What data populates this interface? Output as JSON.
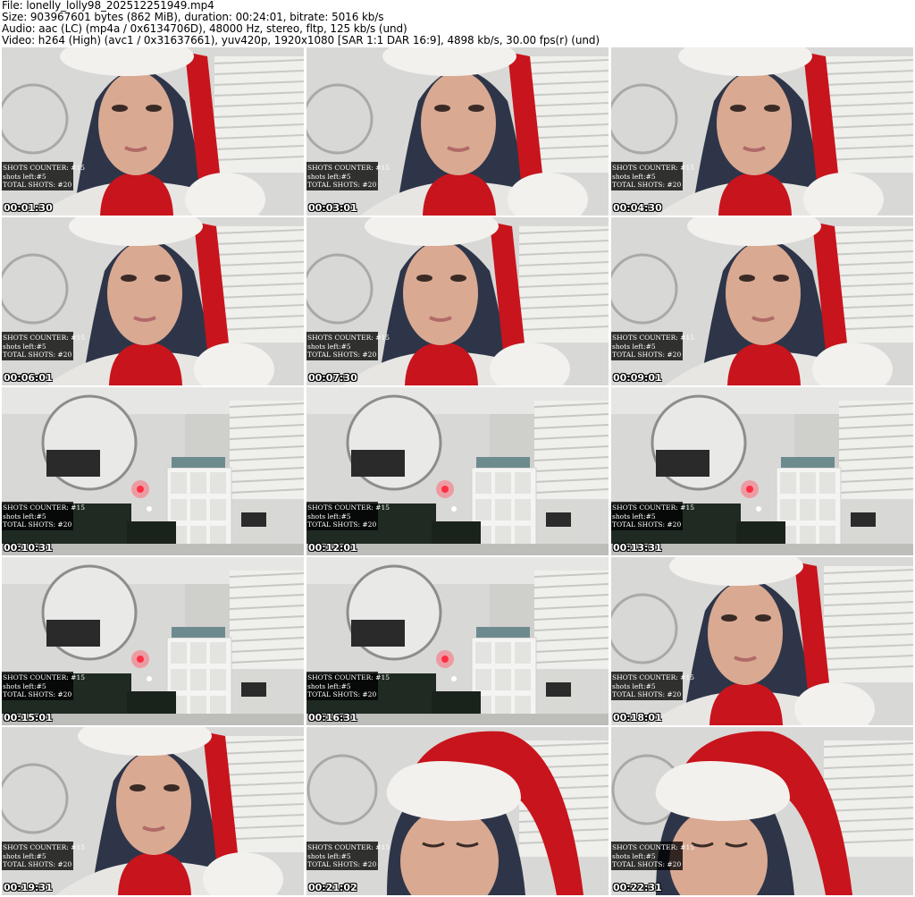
{
  "header": {
    "file_line": "File: lonelly_lolly98_202512251949.mp4",
    "size_line": "Size: 903967601 bytes (862 MiB), duration: 00:24:01, bitrate: 5016 kb/s",
    "audio_line": "Audio: aac (LC) (mp4a / 0x6134706D), 48000 Hz, stereo, fltp, 125 kb/s (und)",
    "video_line": "Video: h264 (High) (avc1 / 0x31637661), yuv420p, 1920x1080 [SAR 1:1 DAR 16:9], 4898 kb/s, 30.00 fps(r) (und)"
  },
  "overlay": {
    "shots_counter": "SHOTS COUNTER:  #15",
    "shots_left": "shots left:#5",
    "total_shots": "TOTAL SHOTS: #20"
  },
  "thumbnails": [
    {
      "timestamp": "00:01:30",
      "scene": "person"
    },
    {
      "timestamp": "00:03:01",
      "scene": "person"
    },
    {
      "timestamp": "00:04:30",
      "scene": "person"
    },
    {
      "timestamp": "00:06:01",
      "scene": "person"
    },
    {
      "timestamp": "00:07:30",
      "scene": "person"
    },
    {
      "timestamp": "00:09:01",
      "scene": "person"
    },
    {
      "timestamp": "00:10:31",
      "scene": "room"
    },
    {
      "timestamp": "00:12:01",
      "scene": "room"
    },
    {
      "timestamp": "00:13:31",
      "scene": "room"
    },
    {
      "timestamp": "00:15:01",
      "scene": "room"
    },
    {
      "timestamp": "00:16:31",
      "scene": "room"
    },
    {
      "timestamp": "00:18:01",
      "scene": "person"
    },
    {
      "timestamp": "00:19:31",
      "scene": "person"
    },
    {
      "timestamp": "00:21:02",
      "scene": "hat"
    },
    {
      "timestamp": "00:22:31",
      "scene": "hat"
    }
  ],
  "colors": {
    "wall": "#d8d8d6",
    "blinds": "#efefec",
    "skin": "#d9a992",
    "hair": "#2e3548",
    "santa_red": "#c8141c",
    "fur_white": "#f3f1ee",
    "sweater": "#e8e6e3",
    "couch": "#1f2a22",
    "shelf": "#f4f4f2",
    "overlay_bg": "#000000",
    "timestamp_text": "#ffffff"
  }
}
